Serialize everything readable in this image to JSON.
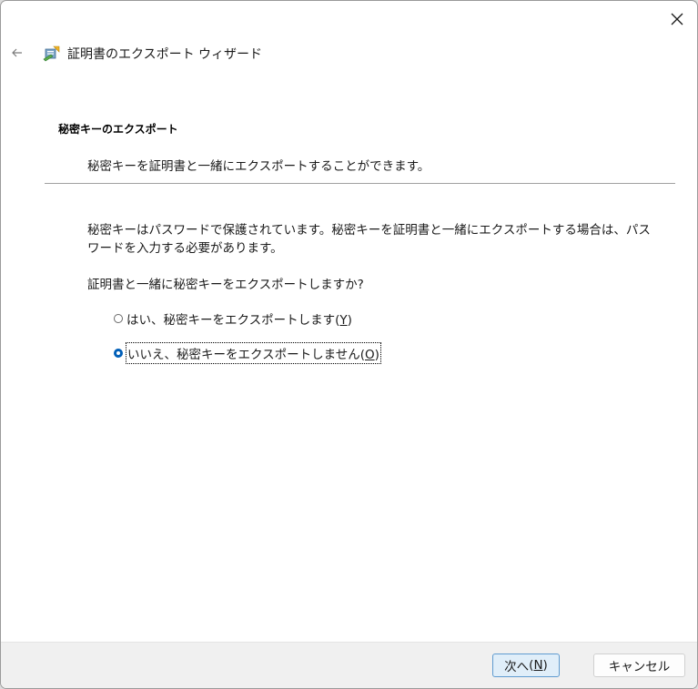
{
  "window": {
    "title": "証明書のエクスポート ウィザード"
  },
  "icons": {
    "close": "close-icon",
    "back": "back-arrow-icon",
    "wizard": "certificate-wizard-icon"
  },
  "section": {
    "heading": "秘密キーのエクスポート",
    "description": "秘密キーを証明書と一緒にエクスポートすることができます。"
  },
  "body": {
    "text": "秘密キーはパスワードで保護されています。秘密キーを証明書と一緒にエクスポートする場合は、パスワードを入力する必要があります。",
    "question": "証明書と一緒に秘密キーをエクスポートしますか?"
  },
  "options": {
    "yes": {
      "label": "はい、秘密キーをエクスポートします",
      "accel": "Y",
      "selected": false
    },
    "no": {
      "label": "いいえ、秘密キーをエクスポートしません",
      "accel": "O",
      "selected": true
    }
  },
  "buttons": {
    "next_label": "次へ",
    "next_accel": "N",
    "cancel_label": "キャンセル"
  },
  "colors": {
    "accent": "#005fb8",
    "footer": "#f0f0f0",
    "next_button_bg": "#e0eef9"
  }
}
